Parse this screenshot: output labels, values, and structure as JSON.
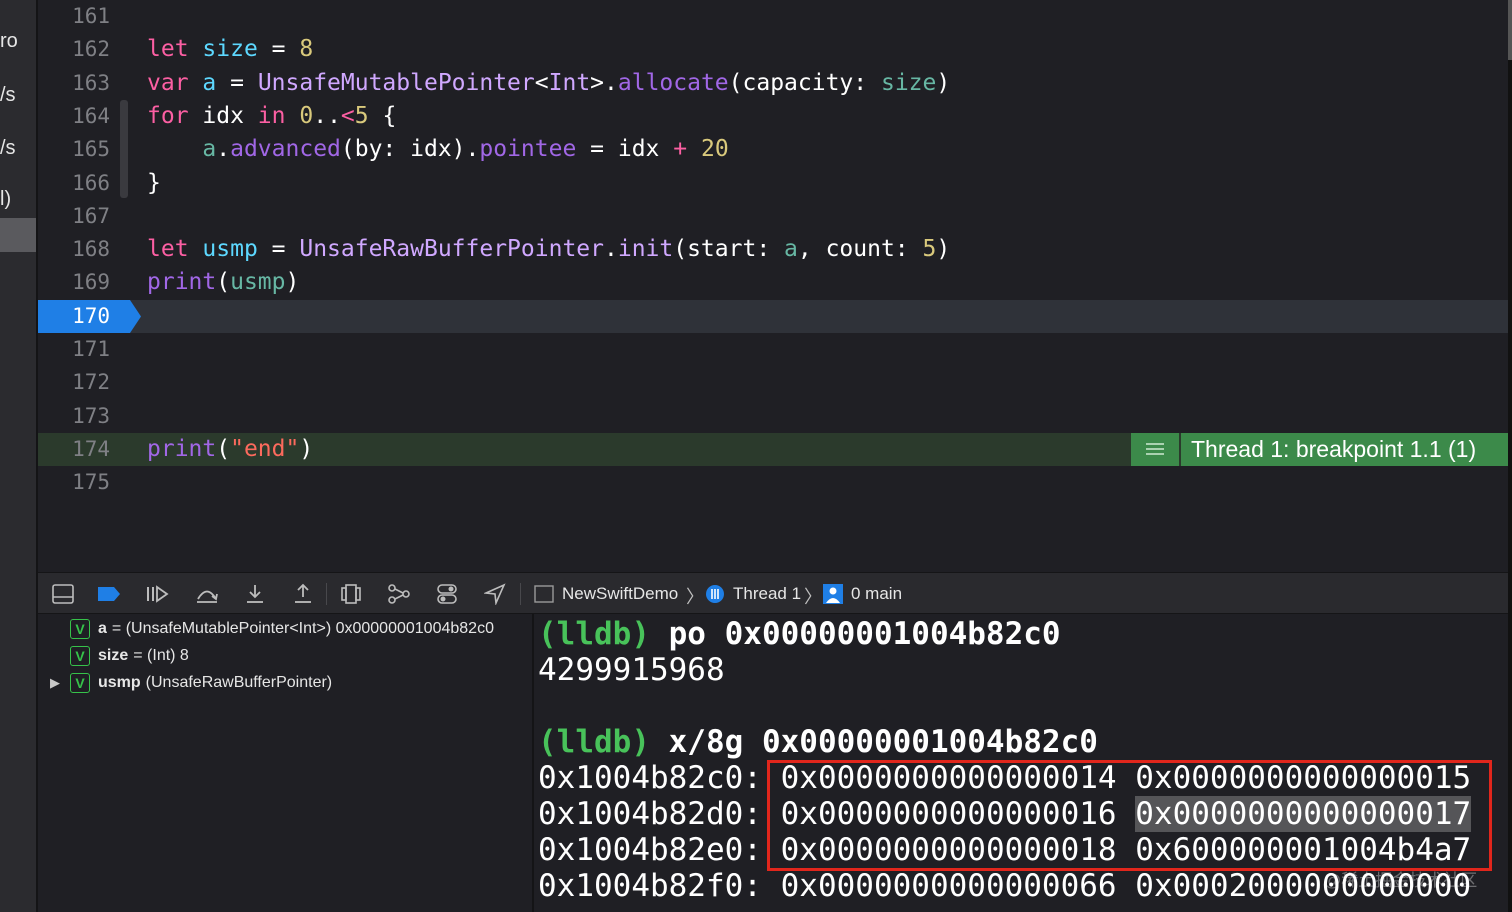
{
  "left_strip": {
    "fragments": [
      "ro",
      "/s",
      "/s",
      "l)"
    ]
  },
  "editor": {
    "lines": [
      {
        "n": "161",
        "tokens": []
      },
      {
        "n": "162",
        "tokens": [
          [
            "kw",
            "let"
          ],
          [
            "lbl",
            " "
          ],
          [
            "var",
            "size"
          ],
          [
            "lbl",
            " = "
          ],
          [
            "num",
            "8"
          ]
        ]
      },
      {
        "n": "163",
        "tokens": [
          [
            "kw",
            "var"
          ],
          [
            "lbl",
            " "
          ],
          [
            "var",
            "a"
          ],
          [
            "lbl",
            " = "
          ],
          [
            "pt",
            "UnsafeMutablePointer"
          ],
          [
            "lbl",
            "<"
          ],
          [
            "pt",
            "Int"
          ],
          [
            "lbl",
            ">."
          ],
          [
            "fn",
            "allocate"
          ],
          [
            "lbl",
            "(capacity: "
          ],
          [
            "cyan2",
            "size"
          ],
          [
            "lbl",
            ")"
          ]
        ]
      },
      {
        "n": "164",
        "tokens": [
          [
            "kw",
            "for"
          ],
          [
            "lbl",
            " idx "
          ],
          [
            "kw",
            "in"
          ],
          [
            "lbl",
            " "
          ],
          [
            "num",
            "0"
          ],
          [
            "lbl",
            ".."
          ],
          [
            "kw",
            "<"
          ],
          [
            "num",
            "5"
          ],
          [
            "lbl",
            " {"
          ]
        ]
      },
      {
        "n": "165",
        "tokens": [
          [
            "lbl",
            "    "
          ],
          [
            "cyan2",
            "a"
          ],
          [
            "lbl",
            "."
          ],
          [
            "fn",
            "advanced"
          ],
          [
            "lbl",
            "(by: idx)."
          ],
          [
            "fn",
            "pointee"
          ],
          [
            "lbl",
            " = idx "
          ],
          [
            "kw",
            "+"
          ],
          [
            "lbl",
            " "
          ],
          [
            "num",
            "20"
          ]
        ]
      },
      {
        "n": "166",
        "tokens": [
          [
            "lbl",
            "}"
          ]
        ]
      },
      {
        "n": "167",
        "tokens": []
      },
      {
        "n": "168",
        "tokens": [
          [
            "kw",
            "let"
          ],
          [
            "lbl",
            " "
          ],
          [
            "var",
            "usmp"
          ],
          [
            "lbl",
            " = "
          ],
          [
            "pt",
            "UnsafeRawBufferPointer"
          ],
          [
            "lbl",
            "."
          ],
          [
            "pt",
            "init"
          ],
          [
            "lbl",
            "(start: "
          ],
          [
            "cyan2",
            "a"
          ],
          [
            "lbl",
            ", count: "
          ],
          [
            "num",
            "5"
          ],
          [
            "lbl",
            ")"
          ]
        ]
      },
      {
        "n": "169",
        "tokens": [
          [
            "fn",
            "print"
          ],
          [
            "lbl",
            "("
          ],
          [
            "cyan2",
            "usmp"
          ],
          [
            "lbl",
            ")"
          ]
        ]
      },
      {
        "n": "170",
        "tokens": []
      },
      {
        "n": "171",
        "tokens": []
      },
      {
        "n": "172",
        "tokens": []
      },
      {
        "n": "173",
        "tokens": []
      },
      {
        "n": "174",
        "tokens": [
          [
            "fn",
            "print"
          ],
          [
            "lbl",
            "("
          ],
          [
            "str",
            "\"end\""
          ],
          [
            "lbl",
            ")"
          ]
        ]
      },
      {
        "n": "175",
        "tokens": []
      }
    ],
    "current_line": "170",
    "breakpoint_line": "174",
    "thread_badge": "Thread 1: breakpoint 1.1 (1)"
  },
  "toolbar": {
    "breadcrumb": {
      "project": "NewSwiftDemo",
      "thread": "Thread 1",
      "frame": "0 main"
    }
  },
  "variables": [
    {
      "badge": "V",
      "name": "a",
      "detail": "= (UnsafeMutablePointer<Int>) 0x00000001004b82c0"
    },
    {
      "badge": "V",
      "name": "size",
      "detail": "= (Int) 8"
    },
    {
      "badge": "V",
      "name": "usmp",
      "detail": "(UnsafeRawBufferPointer)",
      "expandable": true
    }
  ],
  "console": {
    "cmd1_prompt": "(lldb)",
    "cmd1": " po 0x00000001004b82c0",
    "out1": "4299915968",
    "cmd2_prompt": "(lldb)",
    "cmd2": " x/8g 0x00000001004b82c0",
    "mem_rows": [
      {
        "addr": "0x1004b82c0:",
        "v1": "0x0000000000000014",
        "v2": "0x0000000000000015"
      },
      {
        "addr": "0x1004b82d0:",
        "v1": "0x0000000000000016",
        "v2": "0x0000000000000017"
      },
      {
        "addr": "0x1004b82e0:",
        "v1": "0x0000000000000018",
        "v2": "0x600000001004b4a7"
      },
      {
        "addr": "0x1004b82f0:",
        "v1": "0x0000000000000066",
        "v2": "0x0002000000000000"
      }
    ],
    "watermark": "@稀土掘金技术社区"
  },
  "colors": {
    "breakpoint_blue": "#1f7fe6",
    "breakpoint_green": "#3c8a4a",
    "annotation_red": "#e1261c"
  }
}
